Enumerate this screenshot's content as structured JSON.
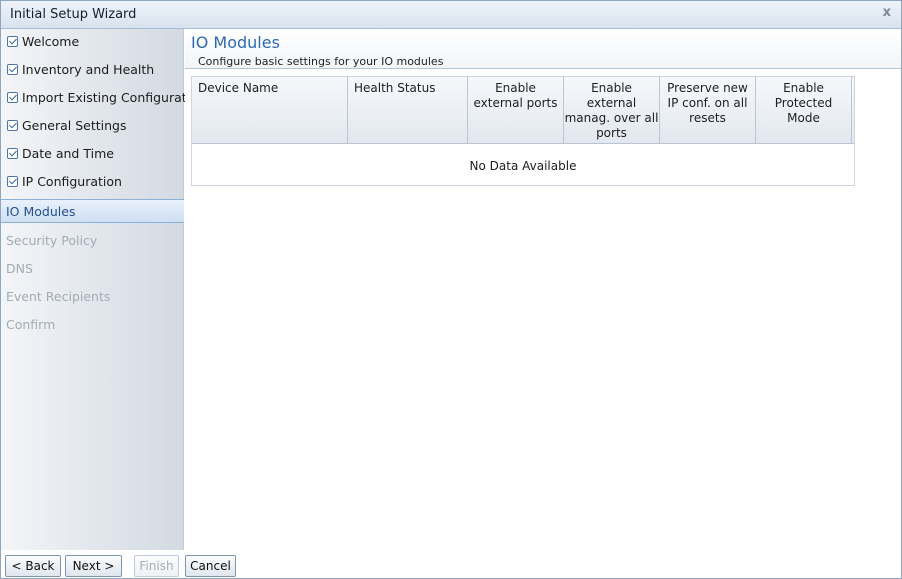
{
  "window": {
    "title": "Initial Setup Wizard",
    "close_glyph": "x"
  },
  "sidebar": {
    "completed_steps": [
      {
        "label": "Welcome"
      },
      {
        "label": "Inventory and Health"
      },
      {
        "label": "Import Existing Configuration"
      },
      {
        "label": "General Settings"
      },
      {
        "label": "Date and Time"
      },
      {
        "label": "IP Configuration"
      }
    ],
    "current_step": {
      "label": "IO Modules"
    },
    "pending_steps": [
      {
        "label": "Security Policy"
      },
      {
        "label": "DNS"
      },
      {
        "label": "Event Recipients"
      },
      {
        "label": "Confirm"
      }
    ]
  },
  "main": {
    "title": "IO Modules",
    "subtitle": "Configure basic settings for your IO modules",
    "table": {
      "columns": [
        {
          "lines": [
            "Device Name"
          ]
        },
        {
          "lines": [
            "Health Status"
          ]
        },
        {
          "lines": [
            "Enable",
            "external ports"
          ]
        },
        {
          "lines": [
            "Enable",
            "external",
            "manag. over all",
            "ports"
          ]
        },
        {
          "lines": [
            "Preserve new",
            "IP conf. on all",
            "resets"
          ]
        },
        {
          "lines": [
            "Enable",
            "Protected",
            "Mode"
          ]
        }
      ],
      "empty_text": "No Data Available"
    }
  },
  "footer": {
    "back_label": "< Back",
    "next_label": "Next >",
    "finish_label": "Finish",
    "cancel_label": "Cancel"
  },
  "colors": {
    "accent": "#2e6bb3",
    "current_step_text": "#23508f",
    "pending_step_text": "#a3abb4"
  }
}
